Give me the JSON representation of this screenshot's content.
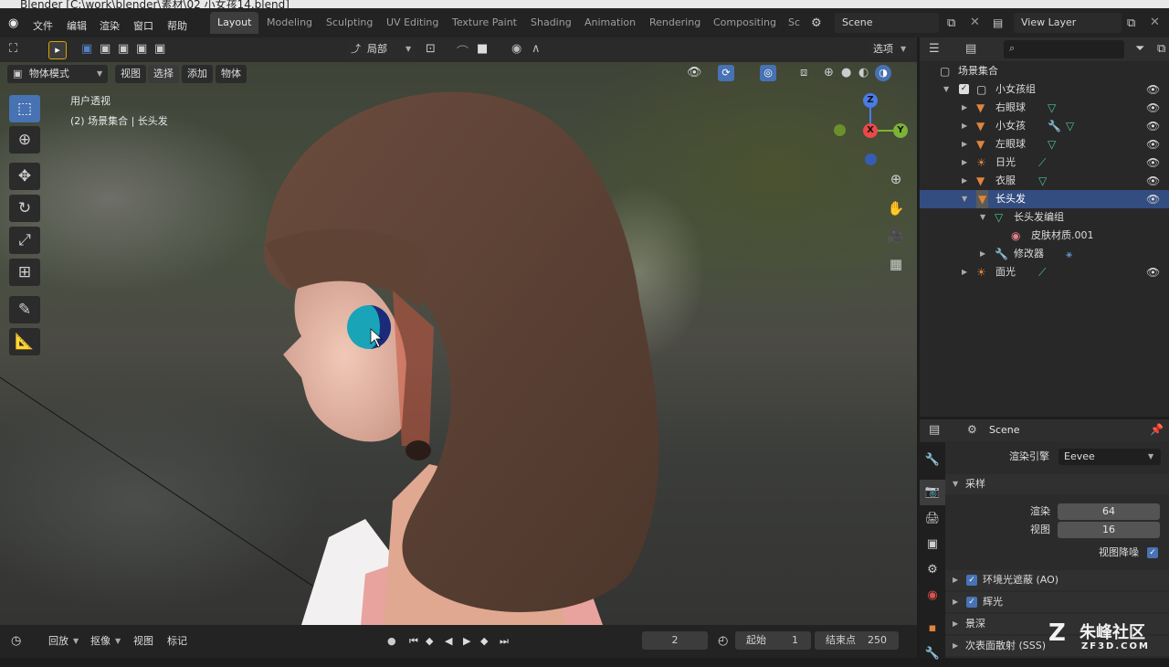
{
  "window": {
    "title": "Blender [C:\\work\\blender\\素材\\02 小女孩14.blend]"
  },
  "menu": {
    "file": "文件",
    "edit": "编辑",
    "render": "渲染",
    "window": "窗口",
    "help": "帮助"
  },
  "workspaces": [
    {
      "label": "Layout",
      "active": true
    },
    {
      "label": "Modeling"
    },
    {
      "label": "Sculpting"
    },
    {
      "label": "UV Editing"
    },
    {
      "label": "Texture Paint"
    },
    {
      "label": "Shading"
    },
    {
      "label": "Animation"
    },
    {
      "label": "Rendering"
    },
    {
      "label": "Compositing"
    },
    {
      "label": "Sc"
    }
  ],
  "scene": {
    "name": "Scene",
    "view_layer": "View Layer"
  },
  "toolbar": {
    "orientation": "局部",
    "options": "选项"
  },
  "viewport": {
    "mode": "物体模式",
    "menus": {
      "view": "视图",
      "select": "选择",
      "add": "添加",
      "object": "物体"
    },
    "overlay_line1": "用户透视",
    "overlay_line2": "(2) 场景集合 | 长头发",
    "gizmo": {
      "z": "Z",
      "x": "X",
      "y": "Y"
    }
  },
  "outliner": {
    "search_placeholder": "",
    "root": "场景集合",
    "rows": [
      {
        "label": "小女孩组",
        "icon": "collection-icon"
      },
      {
        "label": "右眼球",
        "icon": "mesh-object-icon"
      },
      {
        "label": "小女孩",
        "icon": "mesh-object-icon"
      },
      {
        "label": "左眼球",
        "icon": "mesh-object-icon"
      },
      {
        "label": "日光",
        "icon": "light-icon"
      },
      {
        "label": "衣服",
        "icon": "mesh-object-icon"
      },
      {
        "label": "长头发",
        "icon": "mesh-object-icon",
        "selected": true
      },
      {
        "label": "长头发编组",
        "icon": "mesh-data-icon"
      },
      {
        "label": "皮肤材质.001",
        "icon": "material-icon"
      },
      {
        "label": "修改器",
        "icon": "wrench-icon"
      },
      {
        "label": "面光",
        "icon": "light-icon"
      }
    ]
  },
  "properties": {
    "scene_name": "Scene",
    "render_engine_label": "渲染引擎",
    "render_engine": "Eevee",
    "sampling": {
      "header": "采样",
      "render_label": "渲染",
      "render_value": "64",
      "viewport_label": "视图",
      "viewport_value": "16",
      "denoise_label": "视图降噪"
    },
    "panels": [
      "环境光遮蔽 (AO)",
      "辉光",
      "景深",
      "次表面散射 (SSS)"
    ]
  },
  "timeline": {
    "playback": "回放",
    "keying": "抠像",
    "view": "视图",
    "marker": "标记",
    "current_frame": "2",
    "start_label": "起始",
    "start": "1",
    "end_label": "结束点",
    "end": "250"
  },
  "watermark": {
    "text": "朱峰社区",
    "url": "ZF3D.COM"
  },
  "colors": {
    "accent": "#4772b3",
    "selection": "#334d80",
    "brush_cursor": "#19a4b8"
  }
}
